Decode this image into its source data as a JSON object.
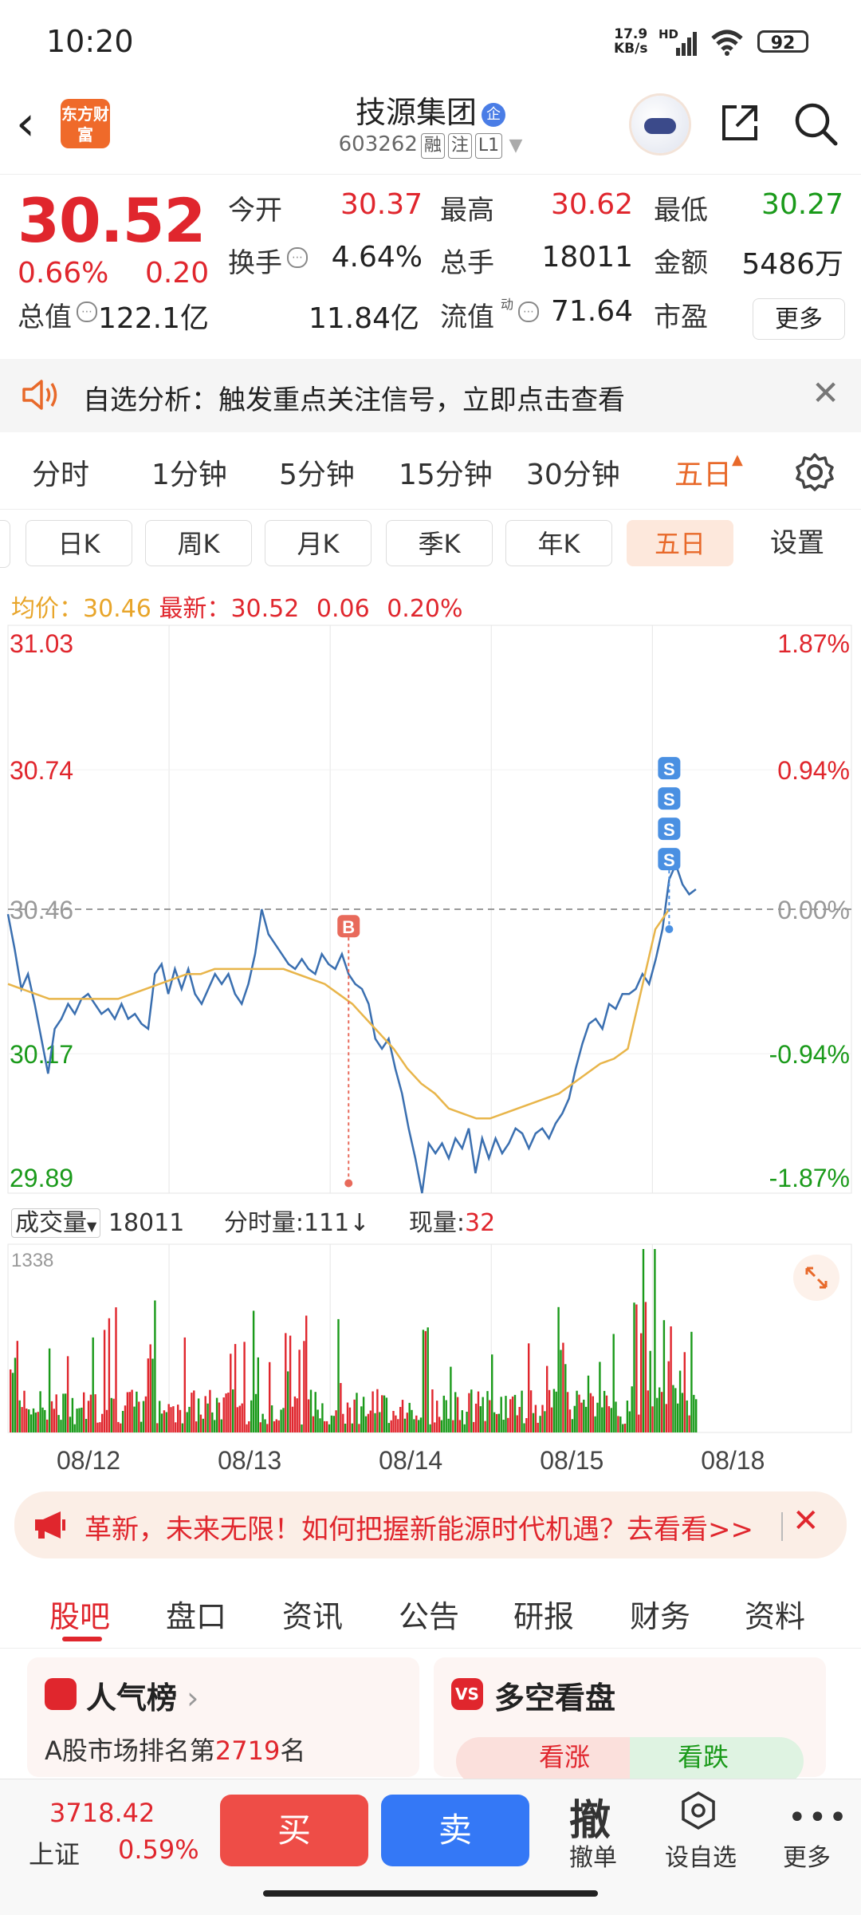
{
  "status_bar": {
    "time": "10:20",
    "net_speed_value": "17.9",
    "net_speed_unit": "KB/s",
    "hd": "HD",
    "battery": "92"
  },
  "header": {
    "logo_text": "东方财富",
    "title": "技源集团",
    "qi_badge": "企",
    "code": "603262",
    "tags": [
      "融",
      "注",
      "L1"
    ]
  },
  "quote": {
    "price": "30.52",
    "change_pct": "0.66%",
    "change_amt": "0.20",
    "fields": [
      {
        "label": "今开",
        "value": "30.37",
        "color": "red"
      },
      {
        "label": "最高",
        "value": "30.62",
        "color": "red"
      },
      {
        "label": "最低",
        "value": "30.27",
        "color": "green"
      },
      {
        "label": "换手",
        "value": "4.64%",
        "color": "black"
      },
      {
        "label": "总手",
        "value": "18011",
        "color": "black"
      },
      {
        "label": "金额",
        "value": "5486万",
        "color": "black"
      },
      {
        "label": "总值",
        "value": "122.1亿",
        "color": "black"
      },
      {
        "label": "流值",
        "value": "11.84亿",
        "color": "black"
      },
      {
        "label": "市盈",
        "value": "71.64",
        "color": "black"
      }
    ],
    "pe_superscript": "动",
    "more_button": "更多"
  },
  "banner": {
    "text": "自选分析：触发重点关注信号，立即点击查看"
  },
  "period_tabs": [
    "分时",
    "1分钟",
    "5分钟",
    "15分钟",
    "30分钟",
    "五日"
  ],
  "k_tabs": [
    "日K",
    "周K",
    "月K",
    "季K",
    "年K",
    "五日"
  ],
  "k_settings": "设置",
  "info_line": {
    "avg_label": "均价：",
    "avg_value": "30.46",
    "latest_label": "最新：",
    "latest_value": "30.52",
    "change": "0.06",
    "pct": "0.20%"
  },
  "volume_header": {
    "label": "成交量",
    "value": "18011",
    "minute_label": "分时量:",
    "minute_value": "111",
    "arrow": "↓",
    "current_label": "现量:",
    "current_value": "32"
  },
  "chart_data": {
    "type": "line",
    "y_left_ticks": [
      "31.03",
      "30.74",
      "30.46",
      "30.17",
      "29.89"
    ],
    "y_right_ticks": [
      "1.87%",
      "0.94%",
      "0.00%",
      "-0.94%",
      "-1.87%"
    ],
    "ylim": [
      29.89,
      31.03
    ],
    "base_price": 30.46,
    "x_labels": [
      "08/12",
      "08/13",
      "08/14",
      "08/15",
      "08/18"
    ],
    "series": [
      {
        "values": [
          30.45,
          30.38,
          30.3,
          30.33,
          30.27,
          30.2,
          30.13,
          30.22,
          30.24,
          30.27,
          30.25,
          30.28,
          30.29,
          30.27,
          30.25,
          30.26,
          30.24,
          30.27,
          30.24,
          30.25,
          30.23,
          30.22,
          30.33,
          30.35,
          30.29,
          30.34,
          30.3,
          30.34,
          30.29,
          30.27,
          30.3,
          30.33,
          30.31,
          30.33,
          30.29,
          30.27,
          30.31,
          30.37,
          30.46,
          30.41,
          30.39,
          30.37,
          30.35,
          30.34,
          30.36,
          30.34,
          30.33,
          30.37,
          30.35,
          30.34,
          30.37,
          30.33,
          30.31,
          30.3,
          30.27,
          30.2,
          30.18,
          30.2,
          30.14,
          30.09,
          30.02,
          29.96,
          29.89,
          29.99,
          29.97,
          29.99,
          29.96,
          30.0,
          29.98,
          30.02,
          29.93,
          30.0,
          29.96,
          30.0,
          29.97,
          29.99,
          30.02,
          30.01,
          29.98,
          30.01,
          30.02,
          30.0,
          30.03,
          30.05,
          30.08,
          30.14,
          30.19,
          30.23,
          30.24,
          30.22,
          30.27,
          30.26,
          30.29,
          30.29,
          30.3,
          30.33,
          30.31,
          30.36,
          30.42,
          30.52,
          30.55,
          30.51,
          30.49,
          30.5
        ]
      },
      {
        "name": "均价",
        "values": [
          30.31,
          30.3,
          30.29,
          30.28,
          30.28,
          30.28,
          30.28,
          30.28,
          30.28,
          30.29,
          30.3,
          30.31,
          30.32,
          30.33,
          30.33,
          30.34,
          30.34,
          30.34,
          30.34,
          30.34,
          30.34,
          30.33,
          30.32,
          30.31,
          30.29,
          30.27,
          30.24,
          30.21,
          30.18,
          30.14,
          30.11,
          30.09,
          30.06,
          30.05,
          30.04,
          30.04,
          30.05,
          30.06,
          30.07,
          30.08,
          30.09,
          30.11,
          30.13,
          30.15,
          30.16,
          30.18,
          30.3,
          30.42,
          30.46
        ]
      }
    ],
    "markers": [
      {
        "label": "B",
        "x_index": 51,
        "color": "#e86a5b"
      },
      {
        "label": "S",
        "x_index": 99,
        "color": "#4a90e2"
      },
      {
        "label": "S",
        "x_index": 99,
        "color": "#4a90e2"
      },
      {
        "label": "S",
        "x_index": 99,
        "color": "#4a90e2"
      },
      {
        "label": "S",
        "x_index": 99,
        "color": "#4a90e2"
      }
    ],
    "volume_max_label": "1338",
    "volume_colors": {
      "up": "#e0262d",
      "down": "#1a9a1a"
    }
  },
  "promo": {
    "text": "革新，未来无限！如何把握新能源时代机遇？去看看>>"
  },
  "bottom_tabs": [
    "股吧",
    "盘口",
    "资讯",
    "公告",
    "研报",
    "财务",
    "资料"
  ],
  "cards": {
    "hot_title": "人气榜",
    "hot_rank_prefix": "A股市场排名第",
    "hot_rank_value": "2719",
    "hot_rank_suffix": "名",
    "vs_title": "多空看盘",
    "vs_badge": "VS",
    "bull_label": "看涨",
    "bear_label": "看跌"
  },
  "bottom_bar": {
    "index_value": "3718.42",
    "index_name": "上证",
    "index_pct": "0.59%",
    "buy": "买",
    "sell": "卖",
    "cancel_glyph": "撤",
    "cancel_label": "撤单",
    "fav_label": "设自选",
    "more_label": "更多"
  },
  "colors": {
    "up": "#e0262d",
    "down": "#1a9a1a",
    "price_line": "#3a6fb0",
    "avg_line": "#e8b54a",
    "accent": "#e8692a"
  }
}
